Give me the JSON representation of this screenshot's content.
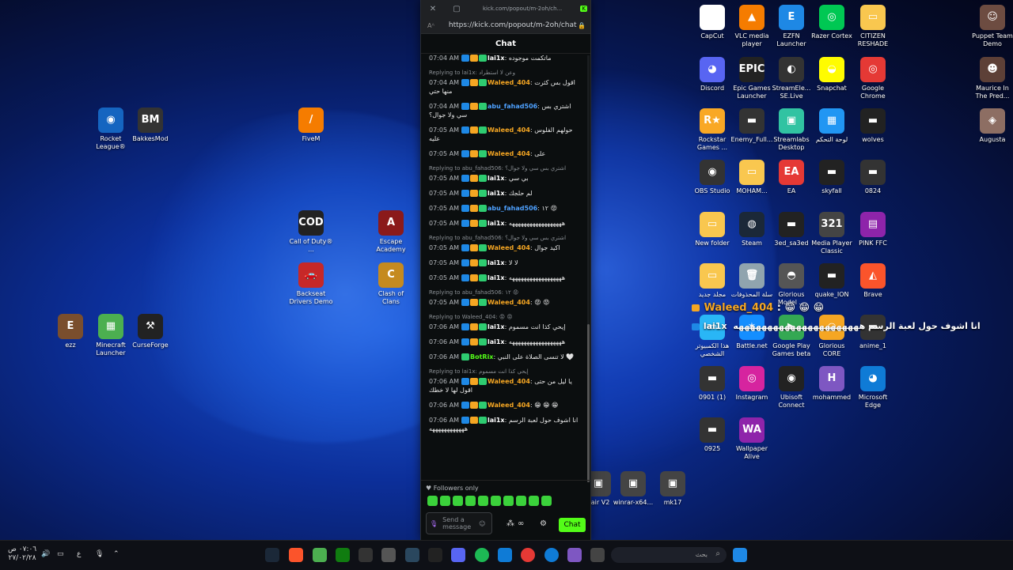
{
  "desktop_left": [
    {
      "label": "Rocket League®",
      "color": "#1565c0",
      "glyph": "◉"
    },
    {
      "label": "BakkesMod",
      "color": "#333",
      "glyph": "BM"
    },
    {
      "label": "FiveM",
      "color": "#f57c00",
      "glyph": "/"
    },
    {
      "label": "Call of Duty® ...",
      "color": "#222",
      "glyph": "COD"
    },
    {
      "label": "Escape Academy",
      "color": "#8b1a1a",
      "glyph": "A"
    },
    {
      "label": "Backseat Drivers Demo",
      "color": "#c62828",
      "glyph": "🚗"
    },
    {
      "label": "Clash of Clans",
      "color": "#c58a1f",
      "glyph": "C"
    },
    {
      "label": "ezz",
      "color": "#7a4e2d",
      "glyph": "E"
    },
    {
      "label": "Minecraft Launcher",
      "color": "#4caf50",
      "glyph": "▦"
    },
    {
      "label": "CurseForge",
      "color": "#222",
      "glyph": "⚒"
    }
  ],
  "desktop_right": [
    {
      "label": "CapCut",
      "color": "#fff",
      "glyph": "✂"
    },
    {
      "label": "VLC media player",
      "color": "#f57c00",
      "glyph": "▲"
    },
    {
      "label": "EZFN Launcher",
      "color": "#1e88e5",
      "glyph": "E"
    },
    {
      "label": "Razer Cortex",
      "color": "#00c853",
      "glyph": "◎"
    },
    {
      "label": "CITIZEN RESHADE",
      "color": "#f9c74f",
      "glyph": "▭"
    },
    {
      "label": "Discord",
      "color": "#5865f2",
      "glyph": "◕"
    },
    {
      "label": "Epic Games Launcher",
      "color": "#222",
      "glyph": "EPIC"
    },
    {
      "label": "StreamEle... SE.Live",
      "color": "#333",
      "glyph": "◐"
    },
    {
      "label": "Snapchat",
      "color": "#fffc00",
      "glyph": "◒"
    },
    {
      "label": "Google Chrome",
      "color": "#e53935",
      "glyph": "◎"
    },
    {
      "label": "Rockstar Games ...",
      "color": "#f9a825",
      "glyph": "R★"
    },
    {
      "label": "Enemy_Full...",
      "color": "#333",
      "glyph": "▬"
    },
    {
      "label": "Streamlabs Desktop",
      "color": "#31c3a2",
      "glyph": "▣"
    },
    {
      "label": "لوحة التحكم",
      "color": "#2196f3",
      "glyph": "▦"
    },
    {
      "label": "wolves",
      "color": "#222",
      "glyph": "▬"
    },
    {
      "label": "OBS Studio",
      "color": "#333",
      "glyph": "◉"
    },
    {
      "label": "MOHAM...",
      "color": "#f9c74f",
      "glyph": "▭"
    },
    {
      "label": "EA",
      "color": "#e53935",
      "glyph": "EA"
    },
    {
      "label": "skyfall",
      "color": "#222",
      "glyph": "▬"
    },
    {
      "label": "0824",
      "color": "#333",
      "glyph": "▬"
    },
    {
      "label": "New folder",
      "color": "#f9c74f",
      "glyph": "▭"
    },
    {
      "label": "Steam",
      "color": "#1b2838",
      "glyph": "◍"
    },
    {
      "label": "3ed_sa3ed",
      "color": "#222",
      "glyph": "▬"
    },
    {
      "label": "Media Player Classic",
      "color": "#444",
      "glyph": "321"
    },
    {
      "label": "PINK FFC",
      "color": "#8e24aa",
      "glyph": "▤"
    },
    {
      "label": "مجلد جديد",
      "color": "#f9c74f",
      "glyph": "▭"
    },
    {
      "label": "سلة المحذوفات",
      "color": "#90a4ae",
      "glyph": "🗑"
    },
    {
      "label": "Glorious Model ...",
      "color": "#555",
      "glyph": "◓"
    },
    {
      "label": "quake_ION",
      "color": "#222",
      "glyph": "▬"
    },
    {
      "label": "Brave",
      "color": "#fb542b",
      "glyph": "◭"
    },
    {
      "label": "هذا الكمبيوتر الشخصي",
      "color": "#29b6f6",
      "glyph": "▭"
    },
    {
      "label": "Battle.net",
      "color": "#148eff",
      "glyph": "✶"
    },
    {
      "label": "Google Play Games beta",
      "color": "#34a853",
      "glyph": "▶"
    },
    {
      "label": "Glorious CORE",
      "color": "#f5a623",
      "glyph": "◒"
    },
    {
      "label": "anime_1",
      "color": "#333",
      "glyph": "▬"
    },
    {
      "label": "0901 (1)",
      "color": "#333",
      "glyph": "▬"
    },
    {
      "label": "Instagram",
      "color": "#d6249f",
      "glyph": "◎"
    },
    {
      "label": "Ubisoft Connect",
      "color": "#222",
      "glyph": "◉"
    },
    {
      "label": "mohammed",
      "color": "#7e57c2",
      "glyph": "H"
    },
    {
      "label": "Microsoft Edge",
      "color": "#0f7bd6",
      "glyph": "◕"
    },
    {
      "label": "0925",
      "color": "#333",
      "glyph": "▬"
    },
    {
      "label": "Wallpaper Alive",
      "color": "#8e24aa",
      "glyph": "WA"
    },
    {
      "label": "Puppet Team Demo",
      "color": "#6d4c41",
      "glyph": "☺"
    },
    {
      "label": "Maurice In The Pred...",
      "color": "#5d4037",
      "glyph": "☻"
    },
    {
      "label": "Augusta",
      "color": "#8d6e63",
      "glyph": "◈"
    }
  ],
  "desktop_middle": [
    {
      "label": "hair V2"
    },
    {
      "label": "winrar-x64..."
    },
    {
      "label": "mk17"
    }
  ],
  "window": {
    "title_url": "kick.com/popout/m-2oh/ch...",
    "address": "https://kick.com/popout/m-2oh/chat",
    "header": "Chat"
  },
  "messages": [
    {
      "reply": "",
      "time": "07:04 AM",
      "user": "lai1x",
      "ucolor": "w",
      "text": "ماتكمت موجوده"
    },
    {
      "reply": "Replying to lai1x: وعن لا استطراد",
      "time": "07:04 AM",
      "user": "Waleed_404",
      "ucolor": "o",
      "text": "اقول بس كثرت منها حتي"
    },
    {
      "reply": "",
      "time": "07:04 AM",
      "user": "abu_fahad506",
      "ucolor": "b",
      "text": "اشتري بس سي ولا جوال؟"
    },
    {
      "reply": "",
      "time": "07:05 AM",
      "user": "Waleed_404",
      "ucolor": "o",
      "text": "حولهم الفلوس عليه"
    },
    {
      "reply": "",
      "time": "07:05 AM",
      "user": "Waleed_404",
      "ucolor": "o",
      "text": "على"
    },
    {
      "reply": "Replying to abu_fahad506: اشتري بس سي ولا جوال؟",
      "time": "07:05 AM",
      "user": "lai1x",
      "ucolor": "w",
      "text": "بي سي"
    },
    {
      "reply": "",
      "time": "07:05 AM",
      "user": "lai1x",
      "ucolor": "w",
      "text": "لم حلجك"
    },
    {
      "reply": "",
      "time": "07:05 AM",
      "user": "abu_fahad506",
      "ucolor": "b",
      "text": "١٢ 😡"
    },
    {
      "reply": "",
      "time": "07:05 AM",
      "user": "lai1x",
      "ucolor": "w",
      "text": "ههههههههههههههههههه"
    },
    {
      "reply": "Replying to abu_fahad506: اشتري بس سي ولا جوال؟",
      "time": "07:05 AM",
      "user": "Waleed_404",
      "ucolor": "o",
      "text": "اكيد جوال"
    },
    {
      "reply": "",
      "time": "07:05 AM",
      "user": "lai1x",
      "ucolor": "w",
      "text": "لا لا"
    },
    {
      "reply": "",
      "time": "07:05 AM",
      "user": "lai1x",
      "ucolor": "w",
      "text": "ههههههههههههههههههه"
    },
    {
      "reply": "Replying to abu_fahad506: ١٢ 😡",
      "time": "07:05 AM",
      "user": "Waleed_404",
      "ucolor": "o",
      "text": "😡 😡"
    },
    {
      "reply": "Replying to Waleed_404: 😡 😡",
      "time": "07:06 AM",
      "user": "lai1x",
      "ucolor": "w",
      "text": "إيحي كذا انت مسموم"
    },
    {
      "reply": "",
      "time": "07:06 AM",
      "user": "lai1x",
      "ucolor": "w",
      "text": "ههههههههههههههههههه"
    },
    {
      "reply": "",
      "time": "07:06 AM",
      "user": "BotRix",
      "ucolor": "g",
      "text": "لا تنسى الصلاة على النبي 🤍"
    },
    {
      "reply": "Replying to lai1x: إيحي كذا انت مسموم",
      "time": "07:06 AM",
      "user": "Waleed_404",
      "ucolor": "o",
      "text": "يا ليل من حتى اقول لها لا خطك"
    },
    {
      "reply": "",
      "time": "07:06 AM",
      "user": "Waleed_404",
      "ucolor": "o",
      "text": "😁 😁 😁"
    },
    {
      "reply": "",
      "time": "07:06 AM",
      "user": "lai1x",
      "ucolor": "w",
      "text": "انا اشوف حول لعبة الرسم ههههههههههههه"
    }
  ],
  "footer": {
    "followers": "Followers only",
    "placeholder": "Send a message",
    "chat_button": "Chat"
  },
  "overlay": {
    "line1_user": "Waleed_404",
    "line1_text": ": 😁 😁 😁",
    "line2_user": "lai1x",
    "line2_text": "انا اشوف حول لعبة الرسم ههههههههههههههههههههههه"
  },
  "taskbar": {
    "search_placeholder": "بحث",
    "time": "٠٧:٠٦ ص",
    "date": "٢٧/٠٢/٢٨",
    "lang": "ع"
  }
}
